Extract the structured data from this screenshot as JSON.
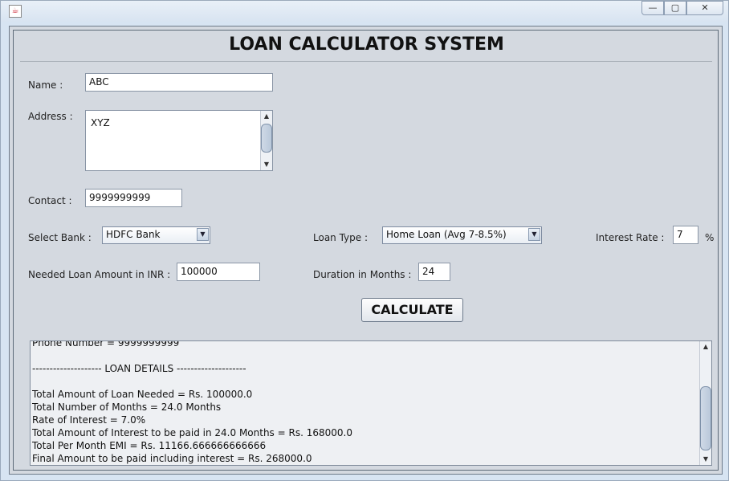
{
  "window": {
    "app_icon": "java-cup-icon",
    "minimize_glyph": "—",
    "maximize_glyph": "▢",
    "close_glyph": "✕"
  },
  "page_title": "LOAN CALCULATOR SYSTEM",
  "form": {
    "name_label": "Name :",
    "name_value": "ABC",
    "address_label": "Address :",
    "address_value": "XYZ",
    "contact_label": "Contact :",
    "contact_value": "9999999999",
    "bank_label": "Select Bank :",
    "bank_value": "HDFC Bank",
    "loan_type_label": "Loan Type :",
    "loan_type_value": "Home Loan (Avg 7-8.5%)",
    "interest_label": "Interest Rate :",
    "interest_value": "7",
    "interest_unit": "%",
    "amount_label": "Needed Loan Amount in INR :",
    "amount_value": "100000",
    "duration_label": "Duration in Months :",
    "duration_value": "24"
  },
  "calculate_label": "CALCULATE",
  "output_lines": [
    "Phone Number = 9999999999",
    "",
    "-------------------- LOAN DETAILS --------------------",
    "",
    "Total Amount of Loan Needed = Rs. 100000.0",
    "Total Number of Months = 24.0 Months",
    "Rate of Interest = 7.0%",
    "Total Amount of Interest to be paid in 24.0 Months = Rs. 168000.0",
    "Total Per Month EMI = Rs. 11166.666666666666",
    "Final Amount to be paid including interest = Rs. 268000.0"
  ],
  "colors": {
    "window_frame": "#d7e4f2",
    "panel_bg": "#d4d9e0"
  }
}
